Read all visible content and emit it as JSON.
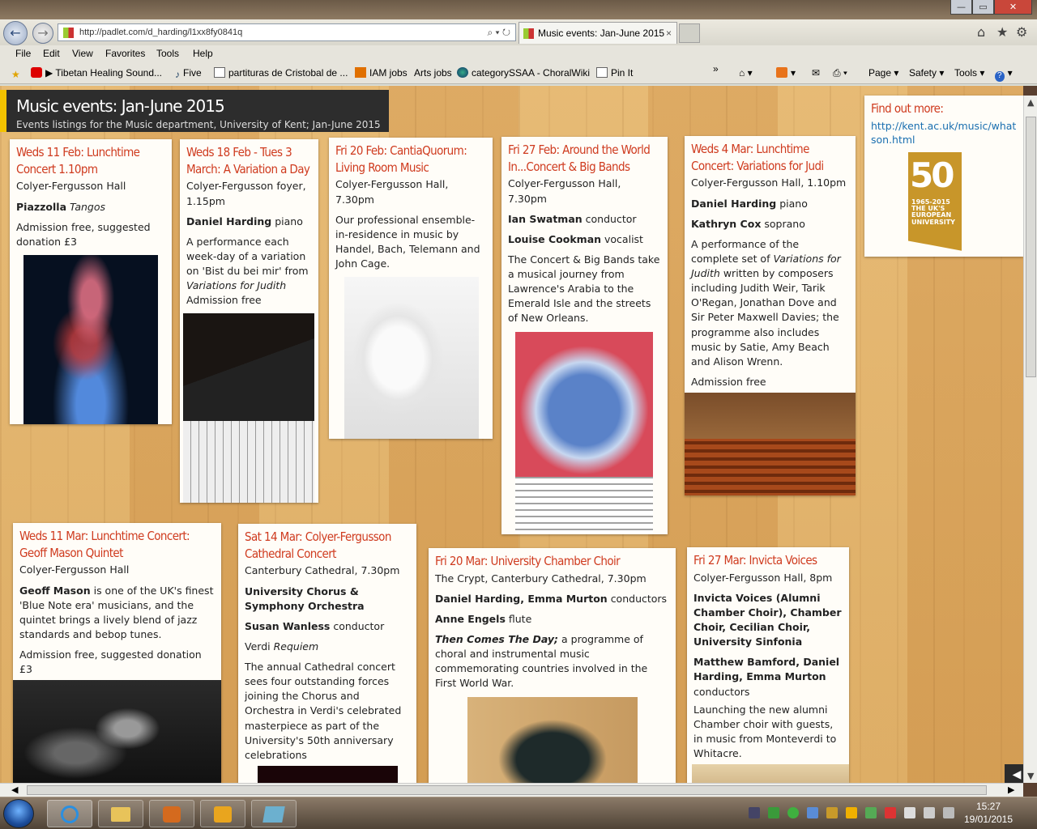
{
  "browser": {
    "url": "http://padlet.com/d_harding/l1xx8fy0841q",
    "tab_title": "Music events: Jan-June 2015",
    "tab_close": "×",
    "back_glyph": "←",
    "forward_glyph": "→"
  },
  "menubar": [
    "File",
    "Edit",
    "View",
    "Favorites",
    "Tools",
    "Help"
  ],
  "favorites": [
    "Tibetan Healing Sound...",
    "Five",
    "partituras de Cristobal de ...",
    "IAM jobs",
    "Arts jobs",
    "categorySSAA - ChoralWiki",
    "Pin It"
  ],
  "command_bar": [
    "Page ▾",
    "Safety ▾",
    "Tools ▾"
  ],
  "banner": {
    "title": "Music events: Jan-June 2015",
    "subtitle": "Events listings for the Music department, University of Kent; Jan-June 2015"
  },
  "sidebar_card": {
    "heading": "Find out more:",
    "link": "http://kent.ac.uk/music/whatson.html",
    "badge_number": "50",
    "badge_text": "1965-2015 THE UK'S EUROPEAN UNIVERSITY"
  },
  "cards": [
    {
      "heading": "Weds 11 Feb: Lunchtime Concert 1.10pm",
      "venue": "Colyer-Fergusson Hall",
      "performer": "Piazzolla",
      "work": "Tangos",
      "note": "Admission free, suggested donation £3"
    },
    {
      "heading": "Weds 18 Feb - Tues 3 March: A Variation a Day",
      "venue": "Colyer-Fergusson foyer, 1.15pm",
      "performer": "Daniel Harding",
      "performer_role": "piano",
      "desc_a": "A performance each week-day of a variation on 'Bist du bei mir' from",
      "desc_work": "Variations for Judith",
      "note": "Admission free"
    },
    {
      "heading": "Fri 20 Feb: CantiaQuorum: Living Room Music",
      "venue": "Colyer-Fergusson Hall, 7.30pm",
      "desc": "Our professional ensemble-in-residence in music by Handel, Bach, Telemann and John Cage."
    },
    {
      "heading": "Fri 27 Feb: Around the World In...Concert & Big Bands",
      "venue": "Colyer-Fergusson Hall, 7.30pm",
      "p1": "Ian Swatman",
      "p1_role": "conductor",
      "p2": "Louise Cookman",
      "p2_role": "vocalist",
      "desc": "The Concert & Big Bands take a musical journey from Lawrence's Arabia to the Emerald Isle and the streets of New Orleans."
    },
    {
      "heading": "Weds 4 Mar: Lunchtime Concert: Variations for Judi",
      "venue": "Colyer-Fergusson Hall, 1.10pm",
      "p1": "Daniel Harding",
      "p1_role": "piano",
      "p2": "Kathryn Cox",
      "p2_role": "soprano",
      "desc_a": "A performance of the complete set of",
      "desc_work": "Variations for Judith",
      "desc_b": "written by composers including Judith Weir, Tarik O'Regan, Jonathan Dove and Sir Peter Maxwell Davies; the programme also includes music by Satie, Amy Beach and Alison Wrenn.",
      "note": "Admission free"
    },
    {
      "heading": "Weds 11 Mar: Lunchtime Concert: Geoff Mason Quintet",
      "venue": "Colyer-Fergusson Hall",
      "performer": "Geoff Mason",
      "desc": "is one of the UK's finest 'Blue Note era' musicians, and the quintet brings a lively blend of jazz standards and bebop tunes.",
      "note": "Admission free, suggested donation £3"
    },
    {
      "heading": "Sat 14 Mar: Colyer-Fergusson Cathedral Concert",
      "venue": "Canterbury Cathedral, 7.30pm",
      "p1": "University Chorus & Symphony Orchestra",
      "p2": "Susan Wanless",
      "p2_role": "conductor",
      "composer": "Verdi",
      "work": "Requiem",
      "desc": "The annual Cathedral concert sees four outstanding forces joining the Chorus and Orchestra in Verdi's celebrated masterpiece as part of the University's 50th anniversary celebrations"
    },
    {
      "heading": "Fri 20 Mar: University Chamber Choir",
      "venue": "The Crypt, Canterbury Cathedral, 7.30pm",
      "p1": "Daniel Harding, Emma Murton",
      "p1_role": "conductors",
      "p2": "Anne Engels",
      "p2_role": "flute",
      "work": "Then Comes The Day;",
      "desc": "a programme of choral and instrumental music commemorating countries involved in the First World War."
    },
    {
      "heading": "Fri 27 Mar: Invicta Voices",
      "venue": "Colyer-Fergusson Hall, 8pm",
      "p1": "Invicta Voices (Alumni Chamber Choir), Chamber Choir, Cecilian Choir, University Sinfonia",
      "p2": "Matthew Bamford, Daniel Harding, Emma Murton",
      "p2_role": "conductors",
      "desc": "Launching the new alumni Chamber choir with guests, in music from Monteverdi to Whitacre."
    }
  ],
  "taskbar": {
    "time": "15:27",
    "date": "19/01/2015"
  },
  "colors": {
    "heading": "#cf3b1f",
    "banner_bg": "#2d2d2d",
    "banner_accent": "#f2c200",
    "link": "#1a6fb0"
  }
}
